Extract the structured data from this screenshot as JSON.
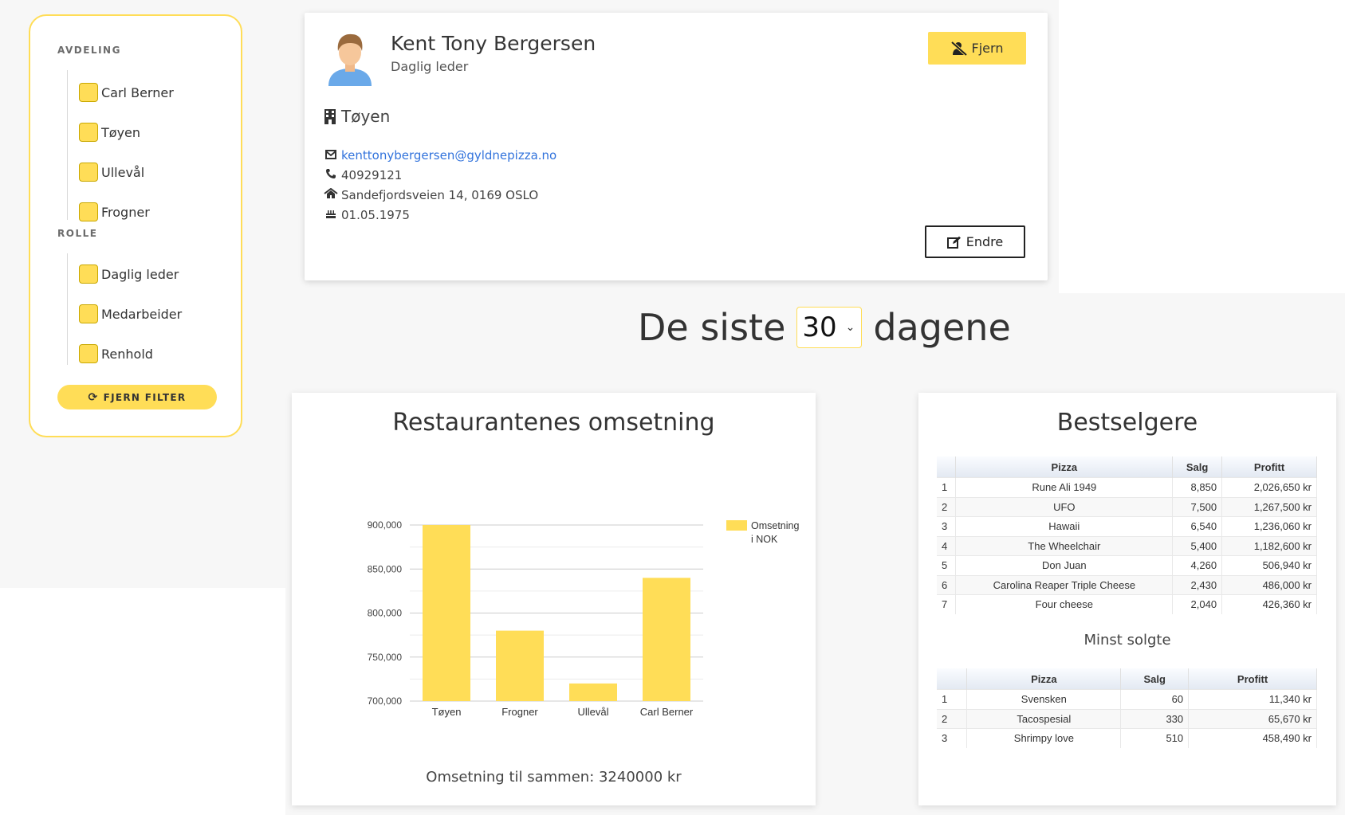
{
  "filter": {
    "avdeling_label": "AVDELING",
    "avdeling_items": [
      "Carl Berner",
      "Tøyen",
      "Ullevål",
      "Frogner"
    ],
    "rolle_label": "ROLLE",
    "rolle_items": [
      "Daglig leder",
      "Medarbeider",
      "Renhold"
    ],
    "clear_button": "FJERN FILTER",
    "clear_icon": "refresh-icon",
    "checkbox_color": "#ffdd57"
  },
  "profile": {
    "name": "Kent Tony Bergersen",
    "role": "Daglig leder",
    "department": "Tøyen",
    "email": "kenttonybergersen@gyldnepizza.no",
    "phone": "40929121",
    "address": "Sandefjordsveien 14, 0169 OSLO",
    "birthdate": "01.05.1975",
    "remove_button": "Fjern",
    "edit_button": "Endre",
    "icons": [
      "user-avatar-icon",
      "user-slash-icon",
      "building-icon",
      "envelope-icon",
      "phone-icon",
      "home-icon",
      "birthday-cake-icon",
      "edit-icon"
    ]
  },
  "period": {
    "prefix": "De siste",
    "value": "30",
    "suffix": "dagene"
  },
  "revenue": {
    "title": "Restaurantenes omsetning",
    "total": "Omsetning til sammen: 3240000 kr"
  },
  "chart_data": {
    "type": "bar",
    "title": "Restaurantenes omsetning",
    "categories": [
      "Tøyen",
      "Frogner",
      "Ullevål",
      "Carl Berner"
    ],
    "series": [
      {
        "name": "Omsetning i NOK",
        "values": [
          900000,
          780000,
          720000,
          840000
        ]
      }
    ],
    "ylim": [
      700000,
      900000
    ],
    "yticks": [
      "900,000",
      "850,000",
      "800,000",
      "750,000",
      "700,000"
    ],
    "ytick_values": [
      900000,
      850000,
      800000,
      750000,
      700000
    ],
    "legend_lines": [
      "Omsetning",
      "i NOK"
    ],
    "legend_position": "right",
    "grid": true,
    "color": "#ffdd57"
  },
  "bestsellers": {
    "title": "Bestselgere",
    "headers": [
      "",
      "Pizza",
      "Salg",
      "Profitt"
    ],
    "rows": [
      [
        "1",
        "Rune Ali 1949",
        "8,850",
        "2,026,650 kr"
      ],
      [
        "2",
        "UFO",
        "7,500",
        "1,267,500 kr"
      ],
      [
        "3",
        "Hawaii",
        "6,540",
        "1,236,060 kr"
      ],
      [
        "4",
        "The Wheelchair",
        "5,400",
        "1,182,600 kr"
      ],
      [
        "5",
        "Don Juan",
        "4,260",
        "506,940 kr"
      ],
      [
        "6",
        "Carolina Reaper Triple Cheese",
        "2,430",
        "486,000 kr"
      ],
      [
        "7",
        "Four cheese",
        "2,040",
        "426,360 kr"
      ]
    ]
  },
  "least_sold": {
    "title": "Minst solgte",
    "headers": [
      "",
      "Pizza",
      "Salg",
      "Profitt"
    ],
    "rows": [
      [
        "1",
        "Svensken",
        "60",
        "11,340 kr"
      ],
      [
        "2",
        "Tacospesial",
        "330",
        "65,670 kr"
      ],
      [
        "3",
        "Shrimpy love",
        "510",
        "458,490 kr"
      ]
    ]
  }
}
